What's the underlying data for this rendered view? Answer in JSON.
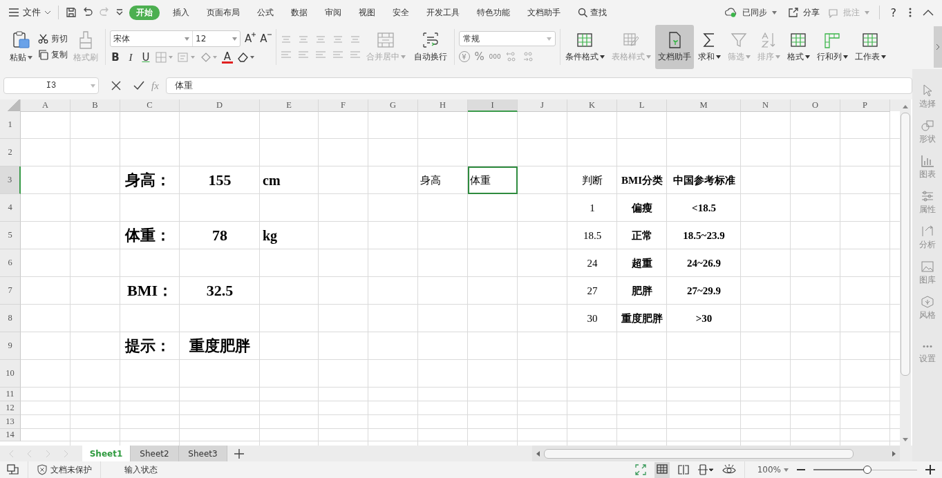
{
  "menu": {
    "file": "文件",
    "tabs": [
      {
        "label": "开始",
        "selected": true
      },
      {
        "label": "插入",
        "selected": false
      },
      {
        "label": "页面布局",
        "selected": false
      },
      {
        "label": "公式",
        "selected": false
      },
      {
        "label": "数据",
        "selected": false
      },
      {
        "label": "审阅",
        "selected": false
      },
      {
        "label": "视图",
        "selected": false
      },
      {
        "label": "安全",
        "selected": false
      },
      {
        "label": "开发工具",
        "selected": false
      },
      {
        "label": "特色功能",
        "selected": false
      },
      {
        "label": "文档助手",
        "selected": false
      }
    ],
    "search": "查找",
    "sync": "已同步",
    "share": "分享",
    "comment": {
      "label": "批注",
      "disabled": true
    },
    "help": "?"
  },
  "ribbon": {
    "clipboard": {
      "paste": "粘贴",
      "cut": "剪切",
      "copy": "复制",
      "painter": {
        "label": "格式刷",
        "disabled": true
      }
    },
    "font": {
      "name": "宋体",
      "size": "12",
      "grow": "A",
      "shrink": "A",
      "styles": [
        "B",
        "I",
        "U"
      ],
      "font_color_button": "A"
    },
    "align": {
      "merge": {
        "label": "合并居中",
        "disabled": true
      },
      "wrap": {
        "label": "自动换行",
        "disabled": false
      }
    },
    "number": {
      "format": "常规",
      "currency": "¥",
      "percent": "%",
      "thousands": "000"
    },
    "tools": [
      {
        "label": "条件格式",
        "dropdown": true,
        "disabled": false,
        "selected": false
      },
      {
        "label": "表格样式",
        "dropdown": true,
        "disabled": true,
        "selected": false
      },
      {
        "label": "文档助手",
        "dropdown": false,
        "disabled": false,
        "selected": true
      },
      {
        "label": "求和",
        "dropdown": true,
        "disabled": false,
        "selected": false
      },
      {
        "label": "筛选",
        "dropdown": true,
        "disabled": true,
        "selected": false
      },
      {
        "label": "排序",
        "dropdown": true,
        "disabled": true,
        "selected": false
      },
      {
        "label": "格式",
        "dropdown": true,
        "disabled": false,
        "selected": false
      },
      {
        "label": "行和列",
        "dropdown": true,
        "disabled": false,
        "selected": false
      },
      {
        "label": "工作表",
        "dropdown": true,
        "disabled": false,
        "selected": false
      }
    ]
  },
  "formula_bar": {
    "name_box": "I3",
    "fx": "fx",
    "value": "体重"
  },
  "columns": [
    {
      "label": "A",
      "selected": false
    },
    {
      "label": "B",
      "selected": false
    },
    {
      "label": "C",
      "selected": false
    },
    {
      "label": "D",
      "selected": false
    },
    {
      "label": "E",
      "selected": false
    },
    {
      "label": "F",
      "selected": false
    },
    {
      "label": "G",
      "selected": false
    },
    {
      "label": "H",
      "selected": false
    },
    {
      "label": "I",
      "selected": true
    },
    {
      "label": "J",
      "selected": false
    },
    {
      "label": "K",
      "selected": false
    },
    {
      "label": "L",
      "selected": false
    },
    {
      "label": "M",
      "selected": false
    },
    {
      "label": "N",
      "selected": false
    },
    {
      "label": "O",
      "selected": false
    },
    {
      "label": "P",
      "selected": false
    }
  ],
  "rows": [
    {
      "label": "1",
      "selected": false,
      "cells": {}
    },
    {
      "label": "2",
      "selected": false,
      "cells": {}
    },
    {
      "label": "3",
      "selected": true,
      "cells": {
        "C": {
          "text": "身高：",
          "kind": "label",
          "selected": false
        },
        "D": {
          "text": "155",
          "kind": "value",
          "selected": false
        },
        "E": {
          "text": "cm",
          "kind": "unit",
          "selected": false
        },
        "H": {
          "text": "身高",
          "kind": "text",
          "selected": false
        },
        "I": {
          "text": "体重",
          "kind": "text",
          "selected": true
        },
        "K": {
          "text": "判断",
          "kind": "num",
          "selected": false
        },
        "L": {
          "text": "BMI分类",
          "kind": "head",
          "selected": false
        },
        "M": {
          "text": "中国参考标准",
          "kind": "head",
          "selected": false
        }
      }
    },
    {
      "label": "4",
      "selected": false,
      "cells": {
        "K": {
          "text": "1",
          "kind": "num",
          "selected": false
        },
        "L": {
          "text": "偏瘦",
          "kind": "head",
          "selected": false
        },
        "M": {
          "text": "<18.5",
          "kind": "head",
          "selected": false
        }
      }
    },
    {
      "label": "5",
      "selected": false,
      "cells": {
        "C": {
          "text": "体重：",
          "kind": "label",
          "selected": false
        },
        "D": {
          "text": "78",
          "kind": "value",
          "selected": false
        },
        "E": {
          "text": "kg",
          "kind": "unit",
          "selected": false
        },
        "K": {
          "text": "18.5",
          "kind": "num",
          "selected": false
        },
        "L": {
          "text": "正常",
          "kind": "head",
          "selected": false
        },
        "M": {
          "text": "18.5~23.9",
          "kind": "head",
          "selected": false
        }
      }
    },
    {
      "label": "6",
      "selected": false,
      "cells": {
        "K": {
          "text": "24",
          "kind": "num",
          "selected": false
        },
        "L": {
          "text": "超重",
          "kind": "head",
          "selected": false
        },
        "M": {
          "text": "24~26.9",
          "kind": "head",
          "selected": false
        }
      }
    },
    {
      "label": "7",
      "selected": false,
      "cells": {
        "C": {
          "text": "BMI：",
          "kind": "value",
          "selected": false
        },
        "D": {
          "text": "32.5",
          "kind": "value",
          "selected": false
        },
        "K": {
          "text": "27",
          "kind": "num",
          "selected": false
        },
        "L": {
          "text": "肥胖",
          "kind": "head",
          "selected": false
        },
        "M": {
          "text": "27~29.9",
          "kind": "head",
          "selected": false
        }
      }
    },
    {
      "label": "8",
      "selected": false,
      "cells": {
        "K": {
          "text": "30",
          "kind": "num",
          "selected": false
        },
        "L": {
          "text": "重度肥胖",
          "kind": "head",
          "selected": false
        },
        "M": {
          "text": ">30",
          "kind": "head",
          "selected": false
        }
      }
    },
    {
      "label": "9",
      "selected": false,
      "cells": {
        "C": {
          "text": "提示：",
          "kind": "label",
          "selected": false
        },
        "D": {
          "text": "重度肥胖",
          "kind": "value",
          "selected": false
        }
      }
    },
    {
      "label": "10",
      "selected": false,
      "cells": {}
    },
    {
      "label": "11",
      "selected": false,
      "cells": {}
    },
    {
      "label": "12",
      "selected": false,
      "cells": {}
    },
    {
      "label": "13",
      "selected": false,
      "cells": {}
    },
    {
      "label": "14",
      "selected": false,
      "cells": {}
    }
  ],
  "sheets": [
    {
      "label": "Sheet1",
      "selected": true
    },
    {
      "label": "Sheet2",
      "selected": false
    },
    {
      "label": "Sheet3",
      "selected": false
    }
  ],
  "side_panel": [
    {
      "label": "选择",
      "disabled": true
    },
    {
      "label": "形状",
      "disabled": true
    },
    {
      "label": "图表",
      "disabled": true
    },
    {
      "label": "属性",
      "disabled": true
    },
    {
      "label": "分析",
      "disabled": true
    },
    {
      "label": "图库",
      "disabled": true
    },
    {
      "label": "风格",
      "disabled": true
    },
    {
      "label": "设置",
      "disabled": true
    }
  ],
  "status_bar": {
    "protection": "文档未保护",
    "mode": "输入状态",
    "zoom": "100%",
    "level": 0.52
  }
}
